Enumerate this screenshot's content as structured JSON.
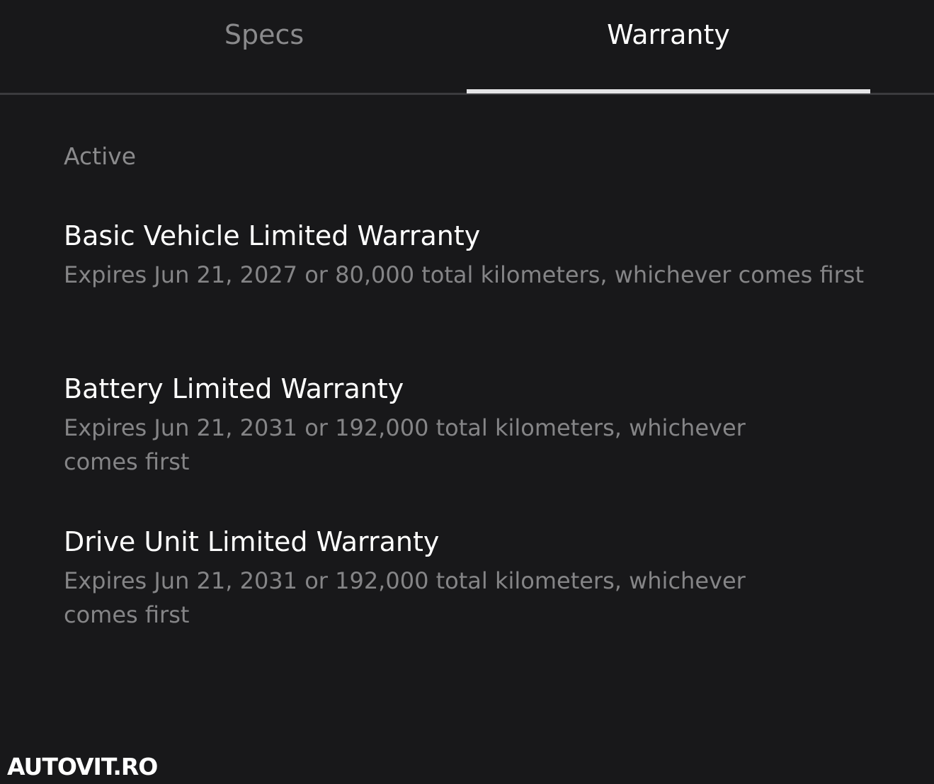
{
  "tabs": [
    {
      "label": "Specs",
      "active": false
    },
    {
      "label": "Warranty",
      "active": true
    }
  ],
  "section": {
    "label": "Active"
  },
  "warranties": [
    {
      "title": "Basic Vehicle Limited Warranty",
      "description": "Expires Jun 21, 2027 or 80,000 total kilometers, whichever comes first"
    },
    {
      "title": "Battery Limited Warranty",
      "description": "Expires Jun 21, 2031 or 192,000 total kilometers, whichever comes first"
    },
    {
      "title": "Drive Unit Limited Warranty",
      "description": "Expires Jun 21, 2031 or 192,000 total kilometers, whichever comes first"
    }
  ],
  "watermark": "AUTOVIT.RO",
  "colors": {
    "background": "#18181a",
    "active_text": "#ffffff",
    "inactive_text": "#8a8a8c",
    "indicator": "#e4e4e6",
    "divider": "#3b3b3e"
  }
}
